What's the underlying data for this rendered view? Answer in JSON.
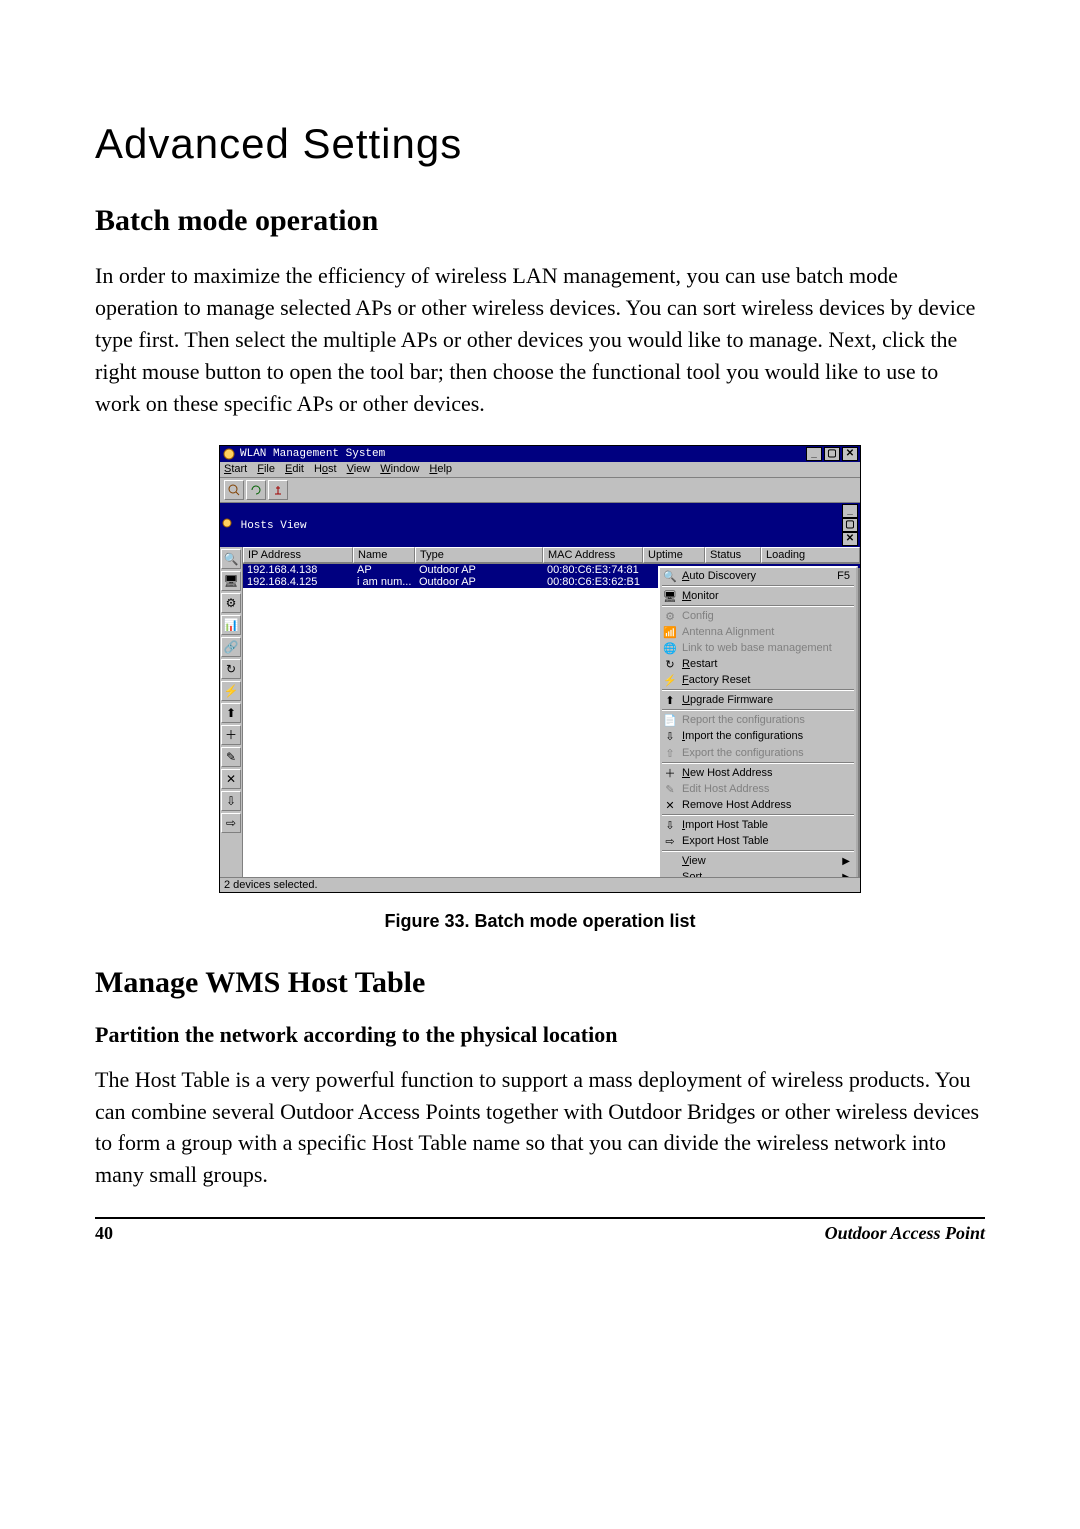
{
  "doc": {
    "title": "Advanced Settings",
    "section1": "Batch mode operation",
    "para1": "In order to maximize the efficiency of wireless LAN management, you can use batch mode operation to manage selected APs or other wireless devices. You can sort wireless devices by device type first. Then select the multiple APs or other devices you would like to manage. Next, click the right mouse button to open the tool bar; then choose the functional tool you would like to use to work on these specific APs or other devices.",
    "figcap": "Figure 33.  Batch mode operation list",
    "section2": "Manage WMS Host Table",
    "sub2": "Partition the network according to the physical location",
    "para2": "The Host Table is a very powerful function to support a mass deployment of wireless products. You can combine several Outdoor Access Points together with Outdoor Bridges or other wireless devices to form a group with a specific Host Table name so that you can divide the wireless network into many small groups.",
    "page": "40",
    "footer": "Outdoor Access Point"
  },
  "shot": {
    "window_title": "WLAN Management System",
    "menus": {
      "start": "Start",
      "file": "File",
      "edit": "Edit",
      "host": "Host",
      "view": "View",
      "window": "Window",
      "help": "Help"
    },
    "inner_title": "Hosts View",
    "columns": {
      "ip": "IP Address",
      "name": "Name",
      "type": "Type",
      "mac": "MAC Address",
      "uptime": "Uptime",
      "status": "Status",
      "loading": "Loading"
    },
    "rows": [
      {
        "ip": "192.168.4.138",
        "name": "AP",
        "type": "Outdoor AP",
        "mac": "00:80:C6:E3:74:81"
      },
      {
        "ip": "192.168.4.125",
        "name": "i am num...",
        "type": "Outdoor AP",
        "mac": "00:80:C6:E3:62:B1"
      }
    ],
    "ctx": {
      "auto_discovery": "Auto Discovery",
      "auto_discovery_key": "F5",
      "monitor": "Monitor",
      "config": "Config",
      "antenna": "Antenna Alignment",
      "linkweb": "Link to web base management",
      "restart": "Restart",
      "factory": "Factory Reset",
      "upgrade": "Upgrade Firmware",
      "report": "Report the configurations",
      "import_cfg": "Import the configurations",
      "export_cfg": "Export the configurations",
      "new_host": "New Host Address",
      "edit_host": "Edit Host Address",
      "remove_host": "Remove Host Address",
      "import_ht": "Import Host Table",
      "export_ht": "Export Host Table",
      "view": "View",
      "sort": "Sort"
    },
    "status": "2 devices selected."
  }
}
